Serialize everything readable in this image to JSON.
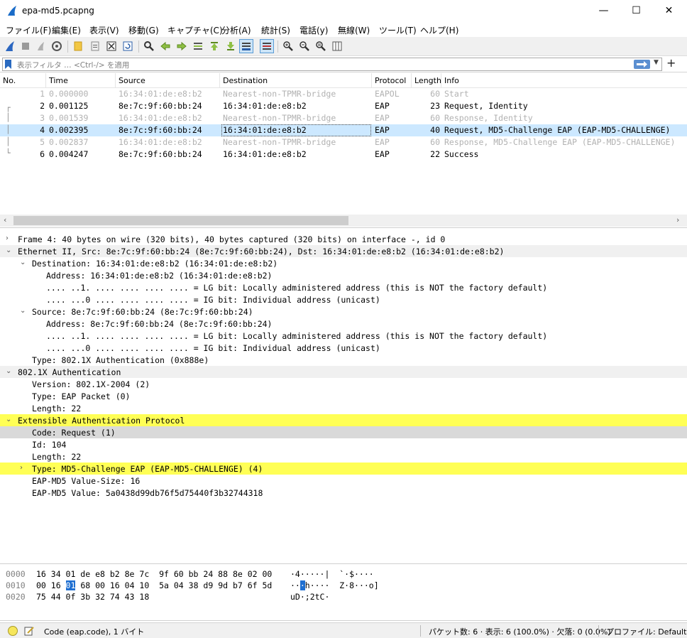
{
  "window": {
    "title": "epa-md5.pcapng",
    "minimize": "—",
    "maximize": "☐",
    "close": "✕"
  },
  "menu": [
    "ファイル(F)",
    "編集(E)",
    "表示(V)",
    "移動(G)",
    "キャプチャ(C)",
    "分析(A)",
    "統計(S)",
    "電話(y)",
    "無線(W)",
    "ツール(T)",
    "ヘルプ(H)"
  ],
  "toolbar": {
    "buttons": [
      "shark-fin-start-icon",
      "stop-icon",
      "restart-icon",
      "options-gear-icon",
      "open-folder-icon",
      "file-binary-icon",
      "close-file-icon",
      "reload-icon",
      "find-icon",
      "go-back-icon",
      "go-forward-icon",
      "go-to-packet-icon",
      "go-first-icon",
      "go-last-icon",
      "auto-scroll-icon",
      "colorize-icon",
      "zoom-in-icon",
      "zoom-out-icon",
      "zoom-reset-icon",
      "resize-columns-icon"
    ]
  },
  "filter": {
    "placeholder": "表示フィルタ … <Ctrl-/> を適用",
    "plus": "+"
  },
  "packet_list": {
    "columns": [
      "No.",
      "Time",
      "Source",
      "Destination",
      "Protocol",
      "Length",
      "Info"
    ],
    "rows": [
      {
        "no": "1",
        "time": "0.000000",
        "source": "16:34:01:de:e8:b2",
        "destination": "Nearest-non-TPMR-bridge",
        "protocol": "EAPOL",
        "length": "60",
        "info": "Start",
        "dim": true
      },
      {
        "no": "2",
        "time": "0.001125",
        "source": "8e:7c:9f:60:bb:24",
        "destination": "16:34:01:de:e8:b2",
        "protocol": "EAP",
        "length": "23",
        "info": "Request, Identity",
        "dim": false
      },
      {
        "no": "3",
        "time": "0.001539",
        "source": "16:34:01:de:e8:b2",
        "destination": "Nearest-non-TPMR-bridge",
        "protocol": "EAP",
        "length": "60",
        "info": "Response, Identity",
        "dim": true
      },
      {
        "no": "4",
        "time": "0.002395",
        "source": "8e:7c:9f:60:bb:24",
        "destination": "16:34:01:de:e8:b2",
        "protocol": "EAP",
        "length": "40",
        "info": "Request, MD5-Challenge EAP (EAP-MD5-CHALLENGE)",
        "dim": false,
        "selected": true
      },
      {
        "no": "5",
        "time": "0.002837",
        "source": "16:34:01:de:e8:b2",
        "destination": "Nearest-non-TPMR-bridge",
        "protocol": "EAP",
        "length": "60",
        "info": "Response, MD5-Challenge EAP (EAP-MD5-CHALLENGE)",
        "dim": true
      },
      {
        "no": "6",
        "time": "0.004247",
        "source": "8e:7c:9f:60:bb:24",
        "destination": "16:34:01:de:e8:b2",
        "protocol": "EAP",
        "length": "22",
        "info": "Success",
        "dim": false
      }
    ]
  },
  "details": [
    {
      "text": "Frame 4: 40 bytes on wire (320 bits), 40 bytes captured (320 bits) on interface -, id 0",
      "expander": "›",
      "style": ""
    },
    {
      "text": "Ethernet II, Src: 8e:7c:9f:60:bb:24 (8e:7c:9f:60:bb:24), Dst: 16:34:01:de:e8:b2 (16:34:01:de:e8:b2)",
      "expander": "⌄",
      "style": "gray"
    },
    {
      "text": "Destination: 16:34:01:de:e8:b2 (16:34:01:de:e8:b2)",
      "expander": "⌄",
      "style": ""
    },
    {
      "text": "Address: 16:34:01:de:e8:b2 (16:34:01:de:e8:b2)",
      "expander": "",
      "style": ""
    },
    {
      "text": ".... ..1. .... .... .... .... = LG bit: Locally administered address (this is NOT the factory default)",
      "expander": "",
      "style": ""
    },
    {
      "text": ".... ...0 .... .... .... .... = IG bit: Individual address (unicast)",
      "expander": "",
      "style": ""
    },
    {
      "text": "Source: 8e:7c:9f:60:bb:24 (8e:7c:9f:60:bb:24)",
      "expander": "⌄",
      "style": ""
    },
    {
      "text": "Address: 8e:7c:9f:60:bb:24 (8e:7c:9f:60:bb:24)",
      "expander": "",
      "style": ""
    },
    {
      "text": ".... ..1. .... .... .... .... = LG bit: Locally administered address (this is NOT the factory default)",
      "expander": "",
      "style": ""
    },
    {
      "text": ".... ...0 .... .... .... .... = IG bit: Individual address (unicast)",
      "expander": "",
      "style": ""
    },
    {
      "text": "Type: 802.1X Authentication (0x888e)",
      "expander": "",
      "style": ""
    },
    {
      "text": "802.1X Authentication",
      "expander": "⌄",
      "style": "gray"
    },
    {
      "text": "Version: 802.1X-2004 (2)",
      "expander": "",
      "style": ""
    },
    {
      "text": "Type: EAP Packet (0)",
      "expander": "",
      "style": ""
    },
    {
      "text": "Length: 22",
      "expander": "",
      "style": ""
    },
    {
      "text": "Extensible Authentication Protocol",
      "expander": "⌄",
      "style": "hl"
    },
    {
      "text": "Code: Request (1)",
      "expander": "",
      "style": "gray2"
    },
    {
      "text": "Id: 104",
      "expander": "",
      "style": ""
    },
    {
      "text": "Length: 22",
      "expander": "",
      "style": ""
    },
    {
      "text": "Type: MD5-Challenge EAP (EAP-MD5-CHALLENGE) (4)",
      "expander": "›",
      "style": "hl"
    },
    {
      "text": "EAP-MD5 Value-Size: 16",
      "expander": "",
      "style": ""
    },
    {
      "text": "EAP-MD5 Value: 5a0438d99db76f5d75440f3b32744318",
      "expander": "",
      "style": ""
    }
  ],
  "hex": [
    {
      "offset": "0000",
      "pre": "16 34 01 de e8 b2 8e 7c  9f 60 bb 24 88 8e 02 00",
      "sel": "",
      "post": "",
      "ascii_pre": "·4·····|  `·$····",
      "ascii_sel": "",
      "ascii_post": ""
    },
    {
      "offset": "0010",
      "pre": "00 16 ",
      "sel": "01",
      "post": " 68 00 16 04 10  5a 04 38 d9 9d b7 6f 5d",
      "ascii_pre": "··",
      "ascii_sel": "·",
      "ascii_post": "h····  Z·8···o]"
    },
    {
      "offset": "0020",
      "pre": "75 44 0f 3b 32 74 43 18",
      "sel": "",
      "post": "",
      "ascii_pre": "uD·;2tC·",
      "ascii_sel": "",
      "ascii_post": ""
    }
  ],
  "status": {
    "field": "Code (eap.code), 1 バイト",
    "packets": "パケット数: 6 · 表示: 6 (100.0%) · 欠落: 0 (0.0%)",
    "profile": "プロファイル: Default"
  }
}
